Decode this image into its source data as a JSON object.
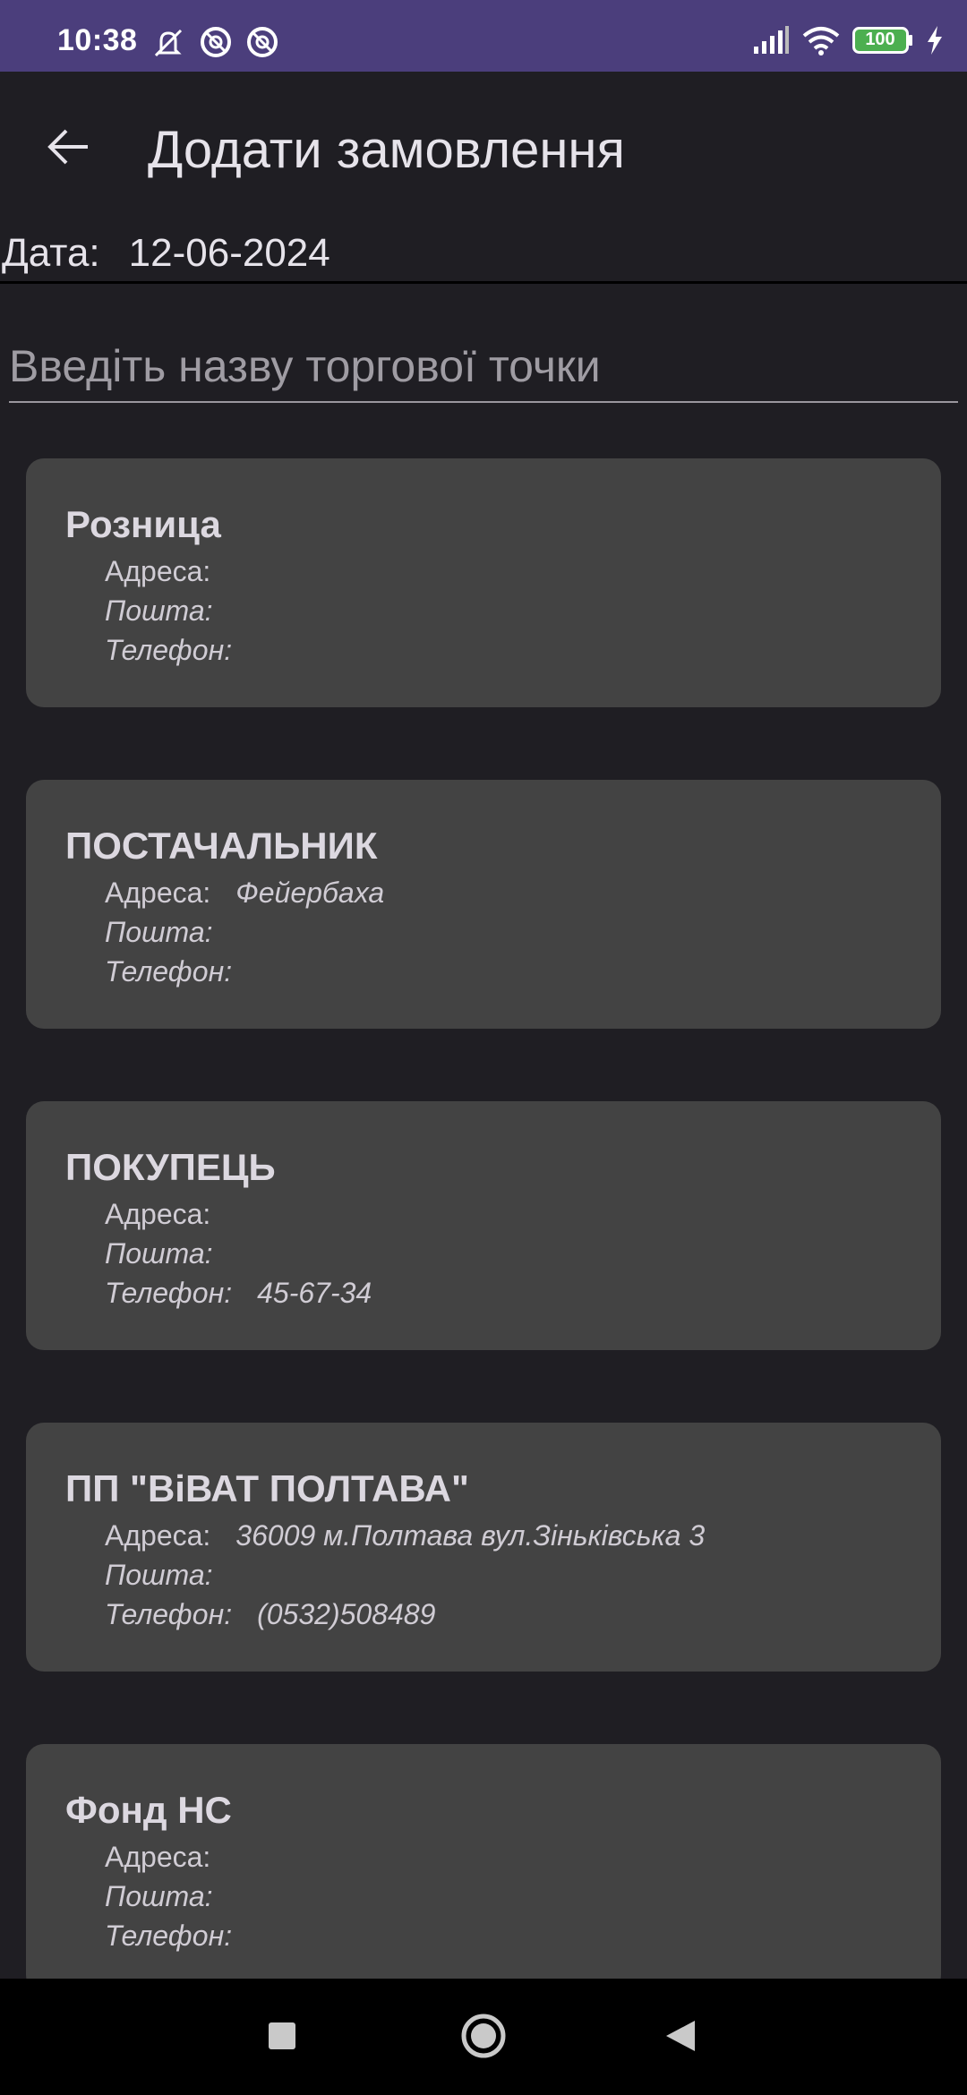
{
  "status_bar": {
    "time": "10:38",
    "battery": "100",
    "icons": [
      "mute-icon",
      "blocked-circle-icon",
      "blocked-circle-icon",
      "signal-icon",
      "wifi-icon",
      "battery-icon",
      "charging-icon"
    ]
  },
  "header": {
    "title": "Додати замовлення"
  },
  "date": {
    "label": "Дата:",
    "value": "12-06-2024"
  },
  "search": {
    "placeholder": "Введіть назву торгової точки"
  },
  "labels": {
    "address": "Адреса:",
    "mail": "Пошта:",
    "phone": "Телефон:"
  },
  "stores": [
    {
      "name": "Розница",
      "address": "",
      "mail": "",
      "phone": ""
    },
    {
      "name": "ПОСТАЧАЛЬНИК",
      "address": "Фейербаха",
      "mail": "",
      "phone": ""
    },
    {
      "name": "ПОКУПЕЦЬ",
      "address": "",
      "mail": "",
      "phone": "45-67-34"
    },
    {
      "name": "ПП \"ВіВАТ ПОЛТАВА\"",
      "address": "36009 м.Полтава вул.Зіньківська 3",
      "mail": "",
      "phone": "(0532)508489"
    },
    {
      "name": "Фонд НС",
      "address": "",
      "mail": "",
      "phone": ""
    }
  ],
  "colors": {
    "status_bar": "#4b3e7c",
    "background": "#1f1e23",
    "card": "#434343"
  }
}
